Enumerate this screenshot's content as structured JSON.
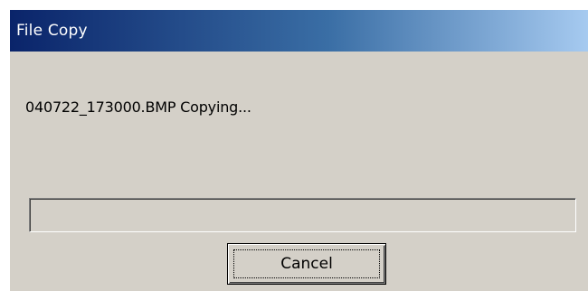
{
  "window": {
    "title": "File Copy"
  },
  "dialog": {
    "status_text": "040722_173000.BMP Copying...",
    "progress_fraction": 0,
    "cancel_label": "Cancel"
  },
  "colors": {
    "titlebar_start": "#0a246a",
    "titlebar_end": "#a6caf0",
    "dialog_face": "#d4d0c8"
  }
}
